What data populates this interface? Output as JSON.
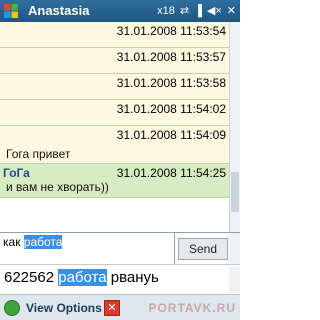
{
  "titlebar": {
    "title": "Anastasia",
    "icons": [
      "x18-icon",
      "sync-icon",
      "signal-icon",
      "volume-icon",
      "close-icon"
    ]
  },
  "chat": {
    "messages": [
      {
        "timestamp": "31.01.2008 11:53:54",
        "text": ""
      },
      {
        "timestamp": "31.01.2008 11:53:57",
        "text": ""
      },
      {
        "timestamp": "31.01.2008 11:53:58",
        "text": ""
      },
      {
        "timestamp": "31.01.2008 11:54:02",
        "text": ""
      },
      {
        "timestamp": "31.01.2008 11:54:09",
        "text": "Гога привет"
      },
      {
        "sender": "ГоГа",
        "timestamp": "31.01.2008 11:54:25",
        "text": "и вам не хворать))"
      }
    ]
  },
  "input": {
    "typed_prefix": "как ",
    "typed_highlight": "работа"
  },
  "send_label": "Send",
  "predict": {
    "number": "622562",
    "highlight": "работа",
    "option": "рвануь"
  },
  "bottombar": {
    "view_options": "View Options",
    "watermark": "PORTAVK.RU"
  },
  "colors": {
    "titlebar": "#1f5680",
    "incoming_bg": "#fff8e1",
    "own_bg": "#d8ecc4",
    "highlight": "#3a8fe0"
  }
}
